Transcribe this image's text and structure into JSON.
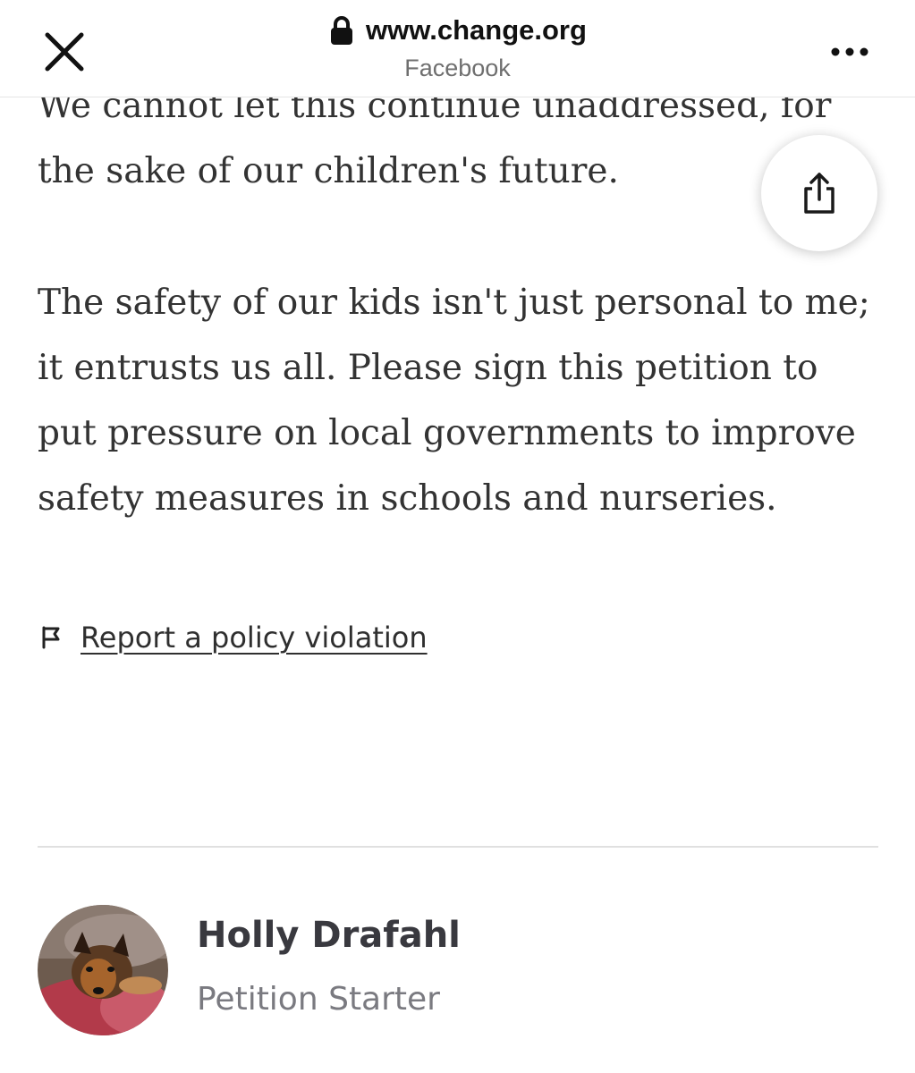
{
  "browser": {
    "url": "www.change.org",
    "source_app": "Facebook",
    "close_icon": "close-icon",
    "lock_icon": "lock-icon",
    "more_icon": "more-options-icon"
  },
  "article": {
    "paragraphs": [
      "We cannot let this continue unaddressed, for the sake of our children's future.",
      "The safety of our kids isn't just personal to me; it entrusts us all. Please sign this petition to put pressure on local governments to improve safety measures in schools and nurseries."
    ]
  },
  "share": {
    "icon": "share-icon"
  },
  "report": {
    "icon": "flag-icon",
    "label": "Report a policy violation"
  },
  "starter": {
    "name": "Holly Drafahl",
    "role": "Petition Starter"
  }
}
